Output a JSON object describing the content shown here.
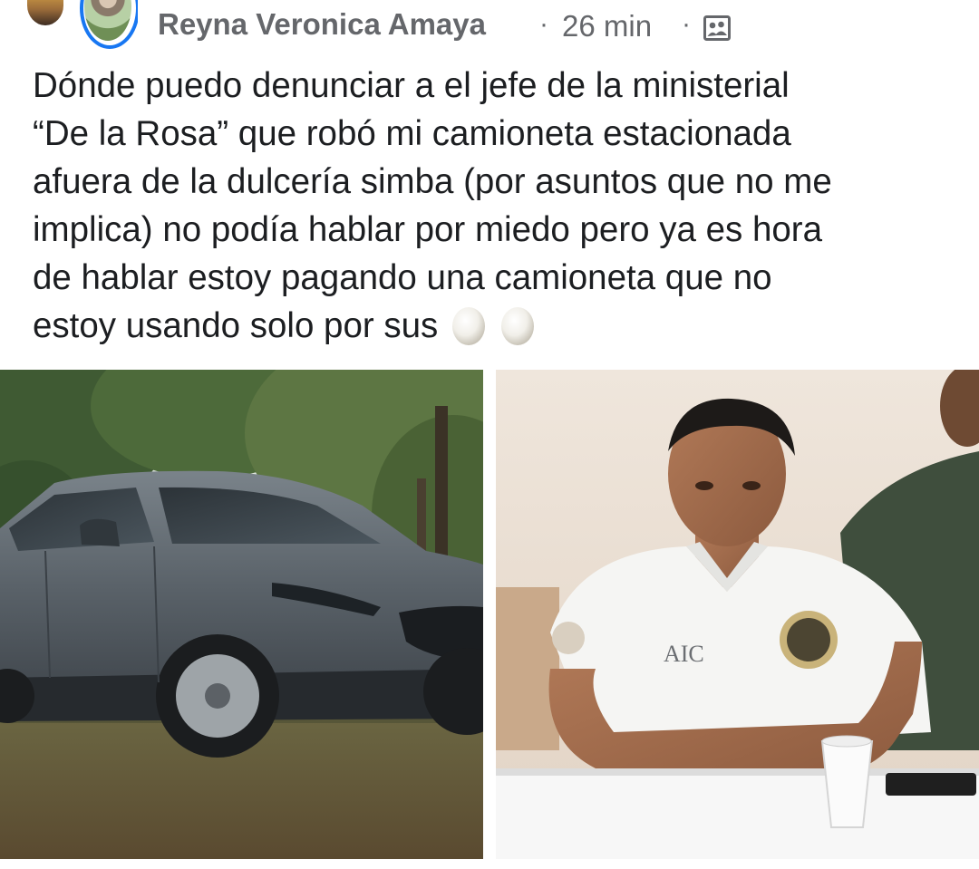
{
  "post": {
    "author": "Reyna Veronica Amaya",
    "separator": "·",
    "time": "26 min",
    "audience_icon": "friends-of-friends-icon",
    "text_lines": [
      "Dónde puedo denunciar a el jefe de la ministerial",
      "“De la Rosa” que robó mi camioneta estacionada",
      "afuera de la dulcería simba (por asuntos que no me",
      "implica) no podía hablar por miedo pero ya es hora",
      "de hablar estoy pagando una camioneta que no",
      "estoy usando solo por sus"
    ],
    "emoji": [
      "egg-emoji",
      "egg-emoji"
    ],
    "photos": [
      {
        "name": "gray-suv-photo"
      },
      {
        "name": "man-white-polo-photo",
        "shirt_text": "AIC"
      }
    ]
  },
  "colors": {
    "meta_text": "#65676b",
    "body_text": "#1c1e21",
    "avatar_ring": "#1877f2"
  }
}
